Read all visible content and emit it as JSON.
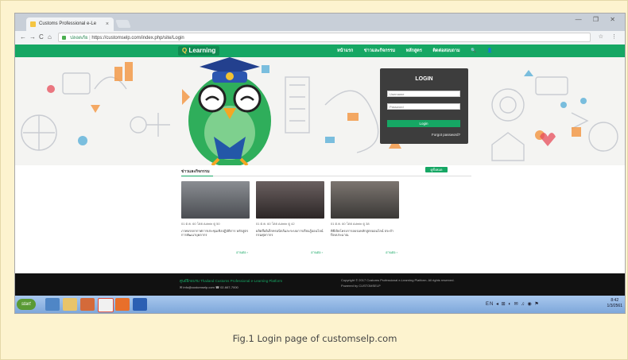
{
  "browser": {
    "tab_title": "Customs Professional e-Le",
    "tab_close": "×",
    "window_controls": "— ❐ ✕",
    "nav_back": "←",
    "nav_forward": "→",
    "nav_reload": "C",
    "nav_home": "⌂",
    "security_label": "ปลอดภัย",
    "url": "https://customselp.com/index.php/site/Login",
    "addr_icons": "☆ ⋮"
  },
  "site": {
    "logo_q": "Q",
    "logo_text": "Learning",
    "nav_items": [
      "หน้าแรก",
      "ข่าวและกิจกรรม",
      "หลักสูตร",
      "ติดต่อสอบถาม",
      "🔍",
      "👤"
    ]
  },
  "login": {
    "title": "LOGIN",
    "username_placeholder": "Username",
    "password_placeholder": "Password",
    "button": "Login",
    "forgot": "Forgot password?"
  },
  "news": {
    "section_title": "ข่าวและกิจกรรม",
    "view_all": "ดูทั้งหมด",
    "cards": [
      {
        "meta": "01 ต.ค. 60 โดย Admin ดู 50",
        "desc": "ภาพบรรยากาศการประชุมเชิงปฏิบัติการ หลักสูตรการพัฒนาบุคลากร",
        "more": "อ่านต่อ ›"
      },
      {
        "meta": "01 ต.ค. 60 โดย Admin ดู 42",
        "desc": "ผลิตสื่ออิเล็กทรอนิกส์และระบบการเรียนรู้ออนไลน์ กรมศุลกากร",
        "more": "อ่านต่อ ›"
      },
      {
        "meta": "01 ต.ค. 60 โดย Admin ดู 38",
        "desc": "พิธีเปิดโครงการอบรมหลักสูตรออนไลน์ ประจำปีงบประมาณ",
        "more": "อ่านต่อ ›"
      }
    ]
  },
  "footer": {
    "line1": "ศูนย์ฝึกอบรม Thailand Customs Professional e-Learning Platform",
    "line2": "✉ info@customselp.com    ☎ 02-667-7000",
    "line3": "Copyright © 2017 Customs Professional e-Learning Platform. All rights reserved.",
    "line4": "Powered by CUSTOMSELP"
  },
  "taskbar": {
    "start_label": "start",
    "tray": "EN ◂ ⊞ ◐ ✉ ♫ ◉ ⚑",
    "time": "8:42",
    "date": "1/3/2561"
  },
  "caption": "Fig.1  Login page of customselp.com"
}
